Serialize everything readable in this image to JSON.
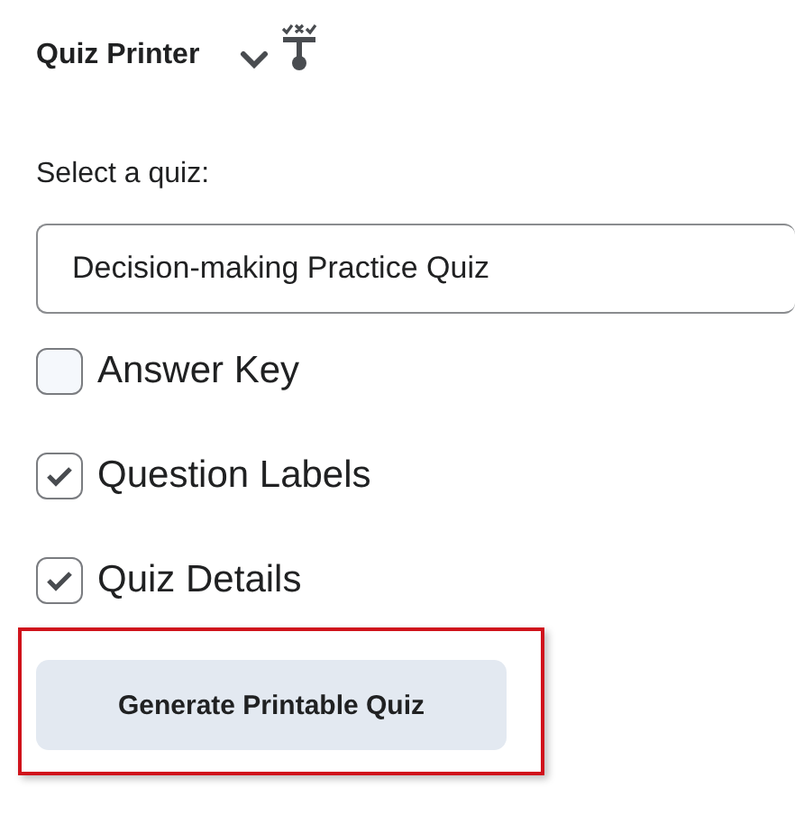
{
  "header": {
    "title": "Quiz Printer"
  },
  "quiz_select": {
    "label": "Select a quiz:",
    "value": "Decision-making Practice Quiz"
  },
  "options": [
    {
      "label": "Answer Key",
      "checked": false
    },
    {
      "label": "Question Labels",
      "checked": true
    },
    {
      "label": "Quiz Details",
      "checked": true
    }
  ],
  "generate_button": {
    "label": "Generate Printable Quiz"
  }
}
